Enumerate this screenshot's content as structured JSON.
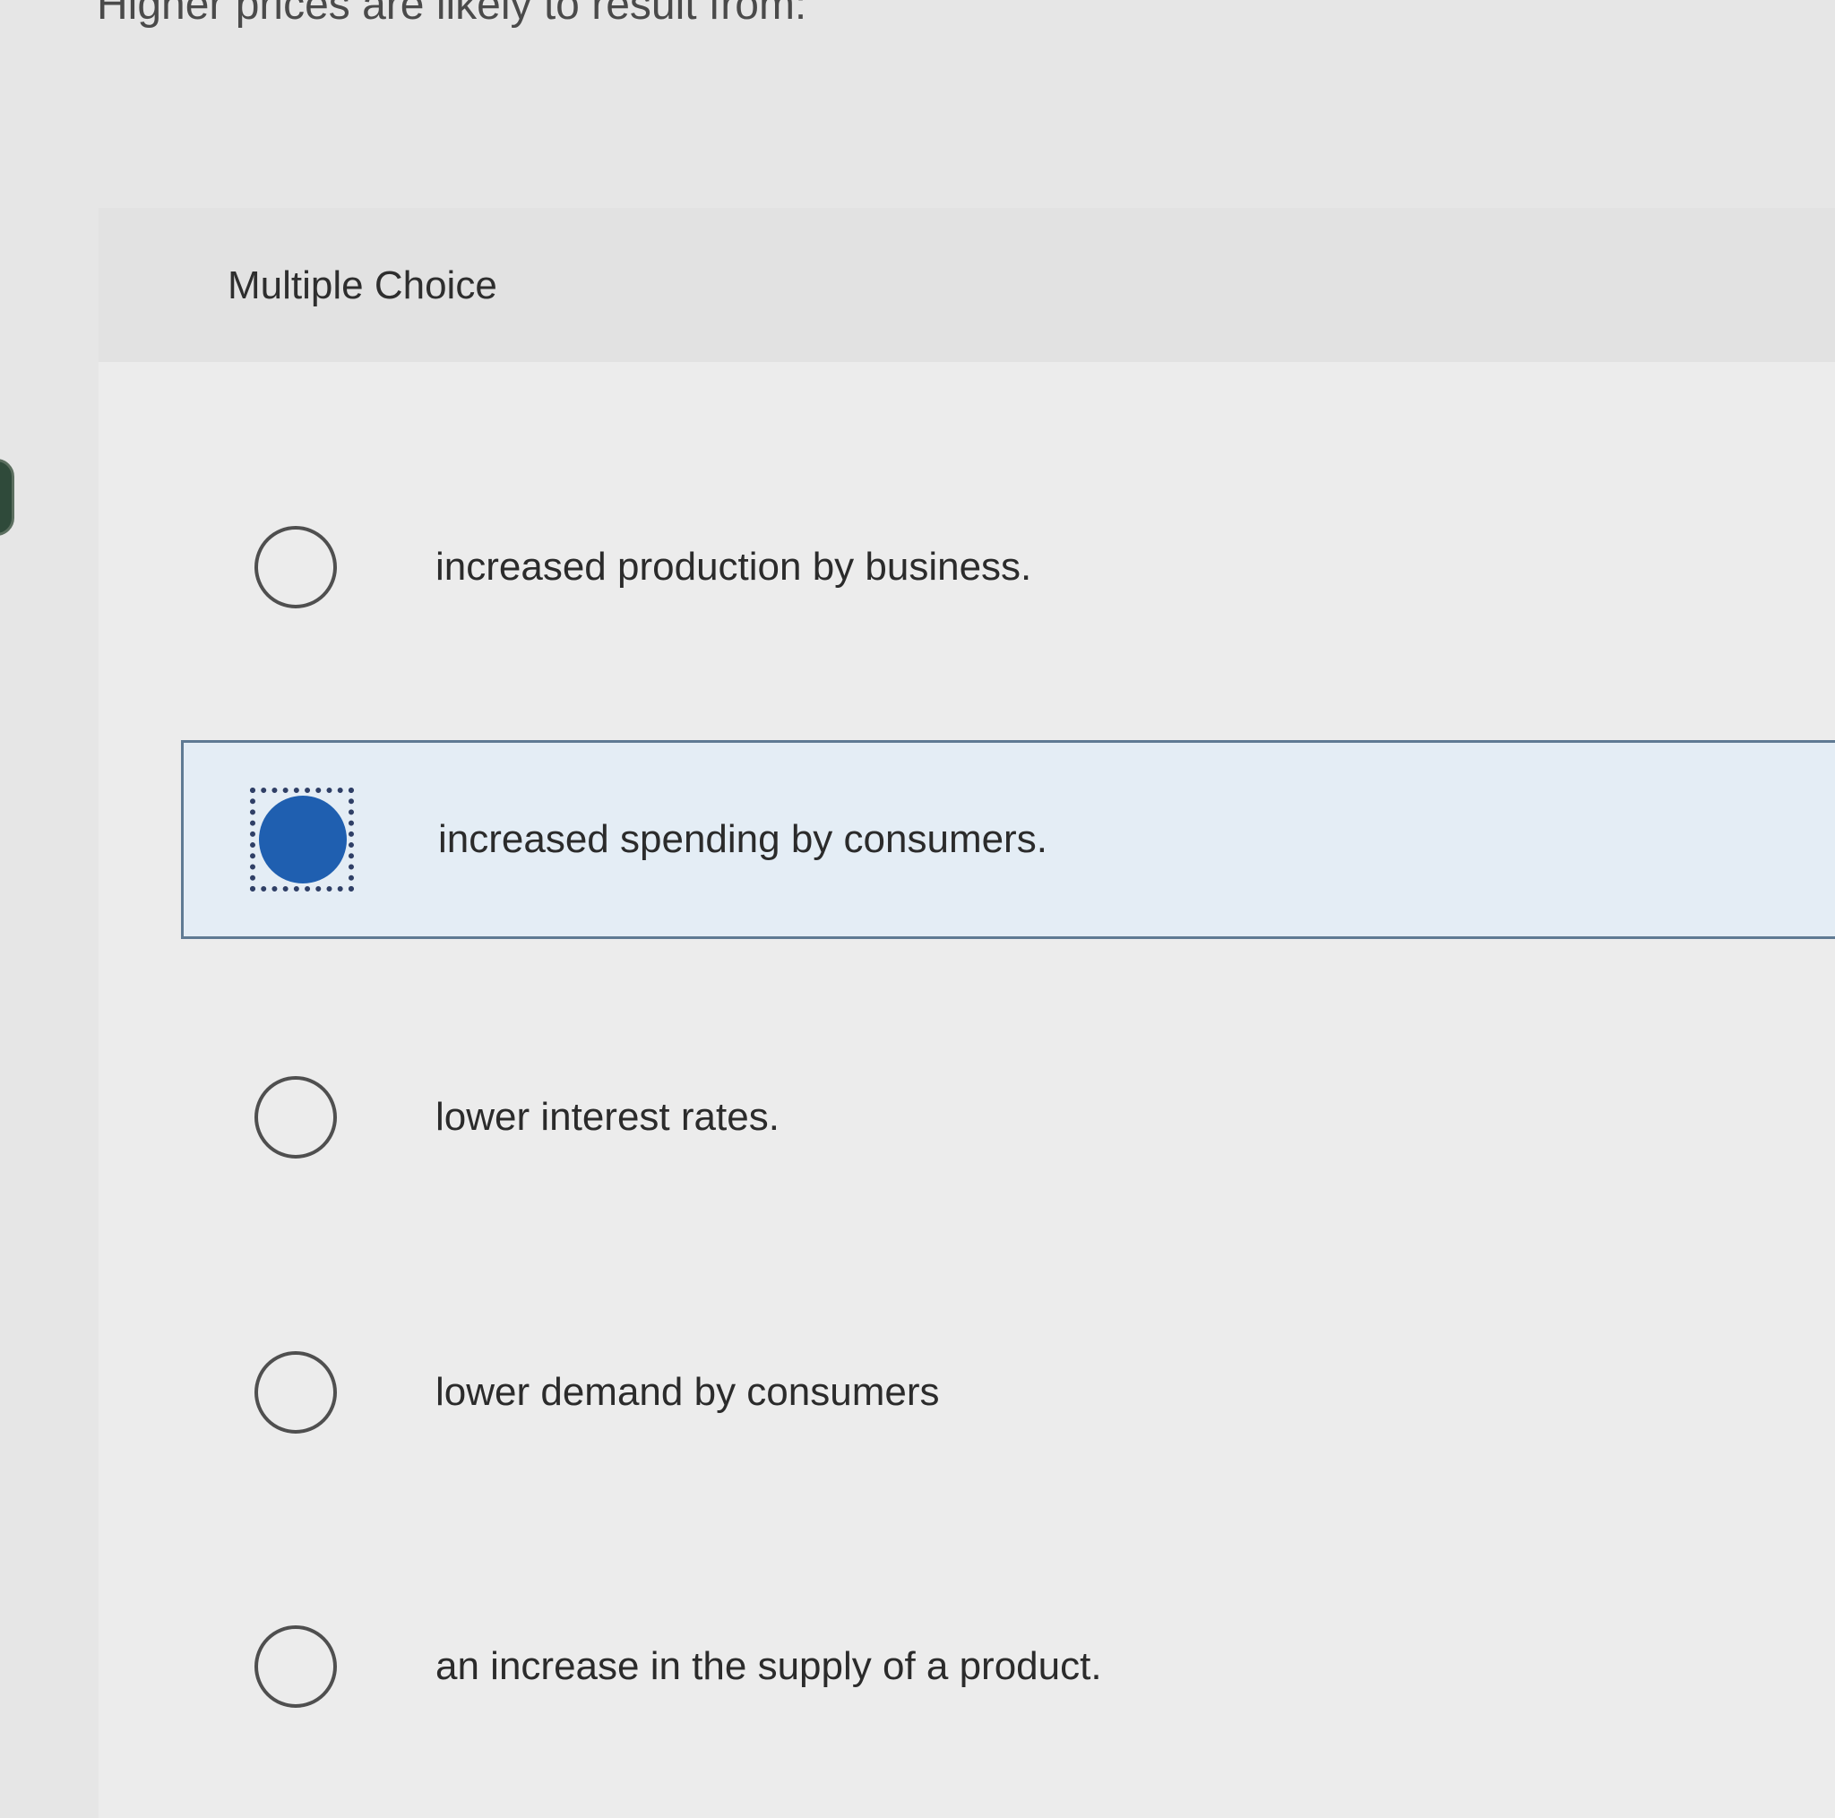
{
  "question": {
    "text": "Higher prices are likely to result from:"
  },
  "panel": {
    "label": "Multiple Choice"
  },
  "choices": [
    {
      "label": "increased production by business.",
      "selected": false
    },
    {
      "label": "increased spending by consumers.",
      "selected": true
    },
    {
      "label": "lower interest rates.",
      "selected": false
    },
    {
      "label": "lower demand by consumers",
      "selected": false
    },
    {
      "label": "an increase in the supply of a product.",
      "selected": false
    }
  ],
  "colors": {
    "selected_radio": "#1f5fb0",
    "selected_background": "#e4edf5",
    "selected_border": "#5f7a93",
    "page_background": "#e6e6e6"
  },
  "icons": {
    "unselected": "radio-unchecked-icon",
    "selected": "radio-checked-icon"
  }
}
